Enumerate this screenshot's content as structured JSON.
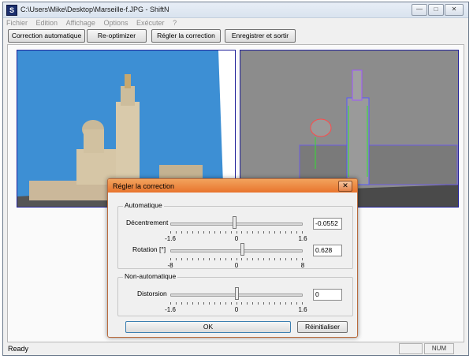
{
  "window": {
    "title": "C:\\Users\\Mike\\Desktop\\Marseille-f.JPG - ShiftN",
    "app_icon_letter": "S",
    "caption_buttons": [
      "—",
      "□",
      "✕"
    ]
  },
  "menu": [
    "Fichier",
    "Edition",
    "Affichage",
    "Options",
    "Exécuter",
    "?"
  ],
  "toolbar": {
    "auto_label": "Correction automatique",
    "reopt_label": "Re-optimizer",
    "adjust_label": "Régler la correction",
    "save_label": "Enregistrer et sortir"
  },
  "status": {
    "text": "Ready",
    "num": "NUM"
  },
  "dialog": {
    "title": "Régler la correction",
    "close": "✕",
    "auto_group": "Automatique",
    "decentrement": {
      "label": "Décentrement",
      "min": "-1.6",
      "mid": "0",
      "max": "1.6",
      "value": "-0.0552",
      "pos": 0.483
    },
    "rotation": {
      "label": "Rotation [°]",
      "min": "-8",
      "mid": "0",
      "max": "8",
      "value": "0.628",
      "pos": 0.539
    },
    "nonauto_group": "Non-automatique",
    "distortion": {
      "label": "Distorsion",
      "min": "-1.6",
      "mid": "0",
      "max": "1.6",
      "value": "0",
      "pos": 0.5
    },
    "ok_label": "OK",
    "reset_label": "Réinitialiser"
  },
  "colors": {
    "sky": "#3d8fd4",
    "dialog_title": "#e8742d",
    "frame": "#20209a"
  }
}
